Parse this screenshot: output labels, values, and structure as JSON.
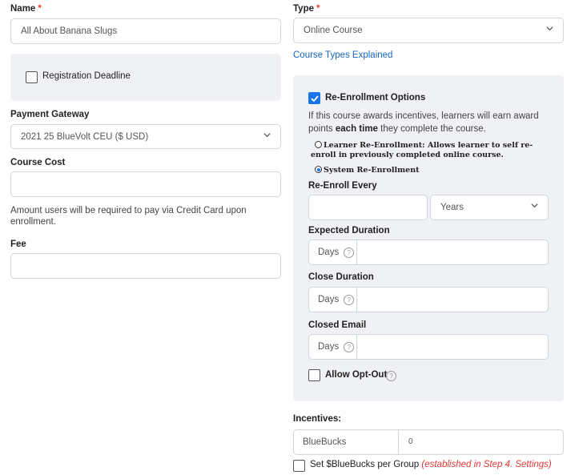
{
  "left": {
    "name_label": "Name",
    "name_required": "*",
    "name_value": "All About Banana Slugs",
    "registration_deadline_label": "Registration Deadline",
    "payment_gateway_label": "Payment Gateway",
    "payment_gateway_value": "2021 25 BlueVolt CEU ($ USD)",
    "course_cost_label": "Course Cost",
    "course_cost_value": "",
    "course_cost_help": "Amount users will be required to pay via Credit Card upon enrollment.",
    "fee_label": "Fee",
    "fee_value": ""
  },
  "right": {
    "type_label": "Type",
    "type_required": "*",
    "type_value": "Online Course",
    "course_types_link": "Course Types Explained",
    "reenroll": {
      "checkbox_label": "Re-Enrollment Options",
      "checked": true,
      "desc_part1": "If this course awards incentives, learners will earn award points ",
      "desc_bold": "each time",
      "desc_part2": " they complete the course.",
      "learner_option": "Learner Re-Enrollment: Allows learner to self re-enroll in previously completed online course.",
      "system_option": "System Re-Enrollment",
      "selected_option": "system",
      "reenroll_every_label": "Re-Enroll Every",
      "reenroll_every_value": "",
      "reenroll_unit": "Years",
      "expected_duration_label": "Expected Duration",
      "close_duration_label": "Close Duration",
      "closed_email_label": "Closed Email",
      "days_prefix": "Days",
      "help_icon": "?",
      "allow_opt_out_label": "Allow Opt-Out"
    },
    "incentives_label": "Incentives:",
    "bluebucks_label": "BlueBucks",
    "bluebucks_value": "0",
    "set_group_label": "Set $BlueBucks per Group",
    "set_group_note": "(established in Step 4. Settings)"
  },
  "colors": {
    "accent": "#1a73e8",
    "required": "#e53935",
    "link": "#1565c0",
    "panel": "#f0f1f4",
    "note": "#e53935"
  }
}
